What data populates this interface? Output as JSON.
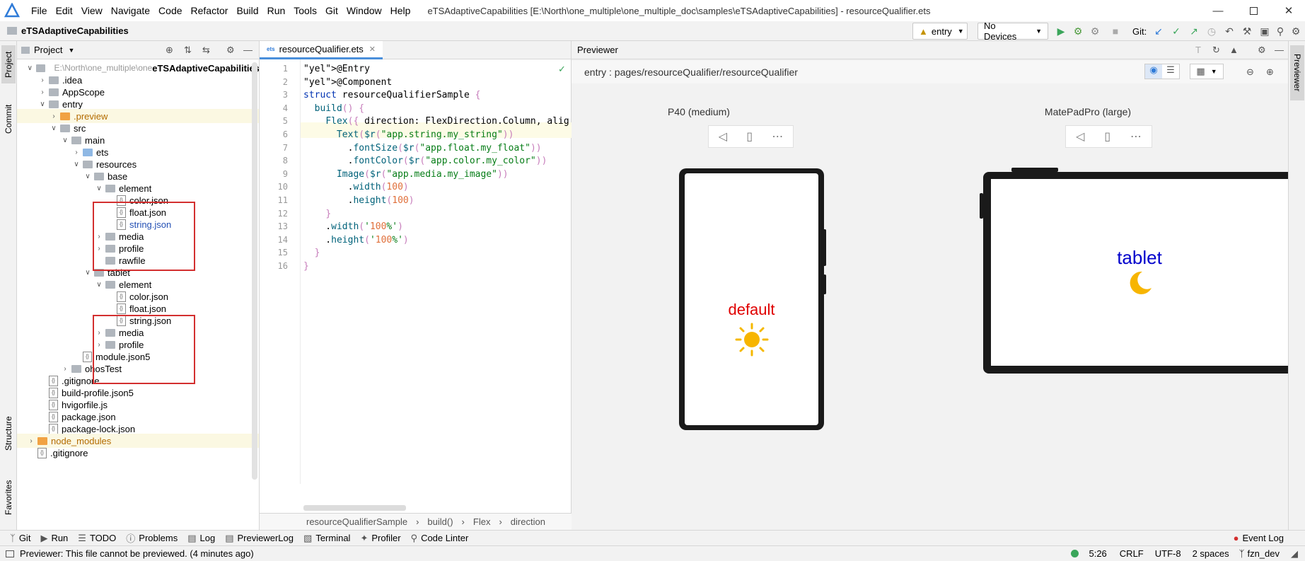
{
  "titlebar": {
    "menu": [
      "File",
      "Edit",
      "View",
      "Navigate",
      "Code",
      "Refactor",
      "Build",
      "Run",
      "Tools",
      "Git",
      "Window",
      "Help"
    ],
    "title": "eTSAdaptiveCapabilities [E:\\North\\one_multiple\\one_multiple_doc\\samples\\eTSAdaptiveCapabilities] - resourceQualifier.ets"
  },
  "navbar": {
    "project": "eTSAdaptiveCapabilities",
    "run_config": "entry",
    "devices": "No Devices",
    "git_label": "Git:"
  },
  "left_tabs": [
    "Project",
    "Commit",
    "Structure",
    "Favorites"
  ],
  "right_tabs": [
    "Previewer"
  ],
  "project_panel": {
    "header": "Project",
    "root_name": "eTSAdaptiveCapabilities",
    "root_path": "E:\\North\\one_multiple\\one",
    "items": [
      {
        "label": ".idea",
        "kind": "folder-gray"
      },
      {
        "label": "AppScope",
        "kind": "folder-gray"
      },
      {
        "label": "entry",
        "kind": "folder-gray"
      },
      {
        "label": ".preview",
        "kind": "folder-orange"
      },
      {
        "label": "src",
        "kind": "folder-gray"
      },
      {
        "label": "main",
        "kind": "folder-gray"
      },
      {
        "label": "ets",
        "kind": "folder-blue"
      },
      {
        "label": "resources",
        "kind": "folder-gray"
      },
      {
        "label": "base",
        "kind": "folder-gray"
      },
      {
        "label": "element",
        "kind": "folder-gray"
      },
      {
        "label": "color.json",
        "kind": "file"
      },
      {
        "label": "float.json",
        "kind": "file"
      },
      {
        "label": "string.json",
        "kind": "file"
      },
      {
        "label": "media",
        "kind": "folder-gray"
      },
      {
        "label": "profile",
        "kind": "folder-gray"
      },
      {
        "label": "rawfile",
        "kind": "folder-gray"
      },
      {
        "label": "tablet",
        "kind": "folder-gray"
      },
      {
        "label": "element",
        "kind": "folder-gray"
      },
      {
        "label": "color.json",
        "kind": "file"
      },
      {
        "label": "float.json",
        "kind": "file"
      },
      {
        "label": "string.json",
        "kind": "file"
      },
      {
        "label": "media",
        "kind": "folder-gray"
      },
      {
        "label": "profile",
        "kind": "folder-gray"
      },
      {
        "label": "module.json5",
        "kind": "file"
      },
      {
        "label": "ohosTest",
        "kind": "folder-gray"
      },
      {
        "label": ".gitignore",
        "kind": "file"
      },
      {
        "label": "build-profile.json5",
        "kind": "file"
      },
      {
        "label": "hvigorfile.js",
        "kind": "file"
      },
      {
        "label": "package.json",
        "kind": "file"
      },
      {
        "label": "package-lock.json",
        "kind": "file"
      },
      {
        "label": "node_modules",
        "kind": "folder-orange"
      },
      {
        "label": ".gitignore",
        "kind": "file"
      }
    ]
  },
  "editor": {
    "tab": "resourceQualifier.ets",
    "line_numbers": [
      "1",
      "2",
      "3",
      "4",
      "5",
      "6",
      "7",
      "8",
      "9",
      "10",
      "11",
      "12",
      "13",
      "14",
      "15",
      "16"
    ],
    "lines": [
      "@Entry",
      "@Component",
      "struct resourceQualifierSample {",
      "  build() {",
      "    Flex({ direction: FlexDirection.Column, alig",
      "      Text($r(\"app.string.my_string\"))",
      "        .fontSize($r(\"app.float.my_float\"))",
      "        .fontColor($r(\"app.color.my_color\"))",
      "      Image($r(\"app.media.my_image\"))",
      "        .width(100)",
      "        .height(100)",
      "    }",
      "    .width('100%')",
      "    .height('100%')",
      "  }",
      "}"
    ],
    "breadcrumb": [
      "resourceQualifierSample",
      "build()",
      "Flex",
      "direction"
    ]
  },
  "previewer": {
    "header": "Previewer",
    "path": "entry : pages/resourceQualifier/resourceQualifier",
    "device1": {
      "label": "P40 (medium)",
      "text": "default",
      "color": "#e00000"
    },
    "device2": {
      "label": "MatePadPro (large)",
      "text": "tablet",
      "color": "#0000cc"
    }
  },
  "bottom_tools": [
    "Git",
    "Run",
    "TODO",
    "Problems",
    "Log",
    "PreviewerLog",
    "Terminal",
    "Profiler",
    "Code Linter"
  ],
  "event_log": "Event Log",
  "status": {
    "message": "Previewer: This file cannot be previewed. (4 minutes ago)",
    "position": "5:26",
    "line_sep": "CRLF",
    "encoding": "UTF-8",
    "indent": "2 spaces",
    "branch": "fzn_dev"
  }
}
